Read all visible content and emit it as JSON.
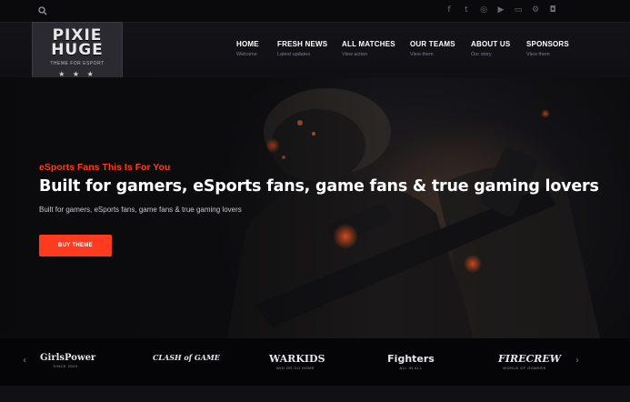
{
  "topbar": {
    "search_icon": "search-icon",
    "social_icons": [
      "facebook-icon",
      "twitter-icon",
      "instagram-icon",
      "youtube-icon",
      "twitch-icon",
      "steam-icon",
      "discord-icon"
    ]
  },
  "logo": {
    "line1": "PIXIE",
    "line2": "HUGE",
    "tagline": "THEME FOR ESPORT",
    "stars": "★ ★ ★"
  },
  "nav": [
    {
      "label": "HOME",
      "sub": "Welcome"
    },
    {
      "label": "FRESH NEWS",
      "sub": "Latest updates"
    },
    {
      "label": "ALL MATCHES",
      "sub": "View action"
    },
    {
      "label": "OUR TEAMS",
      "sub": "View them"
    },
    {
      "label": "ABOUT US",
      "sub": "Our story"
    },
    {
      "label": "SPONSORS",
      "sub": "View them"
    }
  ],
  "hero": {
    "kicker": "eSports Fans This Is For You",
    "title": "Built for gamers, eSports fans, game fans & true gaming lovers",
    "subtitle": "Built for gamers, eSports fans, game fans & true gaming lovers",
    "button": "BUY THEME"
  },
  "sponsors": {
    "items": [
      {
        "name": "GirlsPower",
        "motto": "SINCE 2009"
      },
      {
        "name": "CLASH of GAME",
        "motto": ""
      },
      {
        "name": "WARKIDS",
        "motto": "WIN OR GO HOME"
      },
      {
        "name": "Fighters",
        "motto": "ALL IN ALL"
      },
      {
        "name": "FIRECREW",
        "motto": "WORLD OF GAMERS"
      }
    ],
    "prev": "‹",
    "next": "›"
  },
  "colors": {
    "accent": "#ff3b1f",
    "background": "#0d0d10"
  }
}
